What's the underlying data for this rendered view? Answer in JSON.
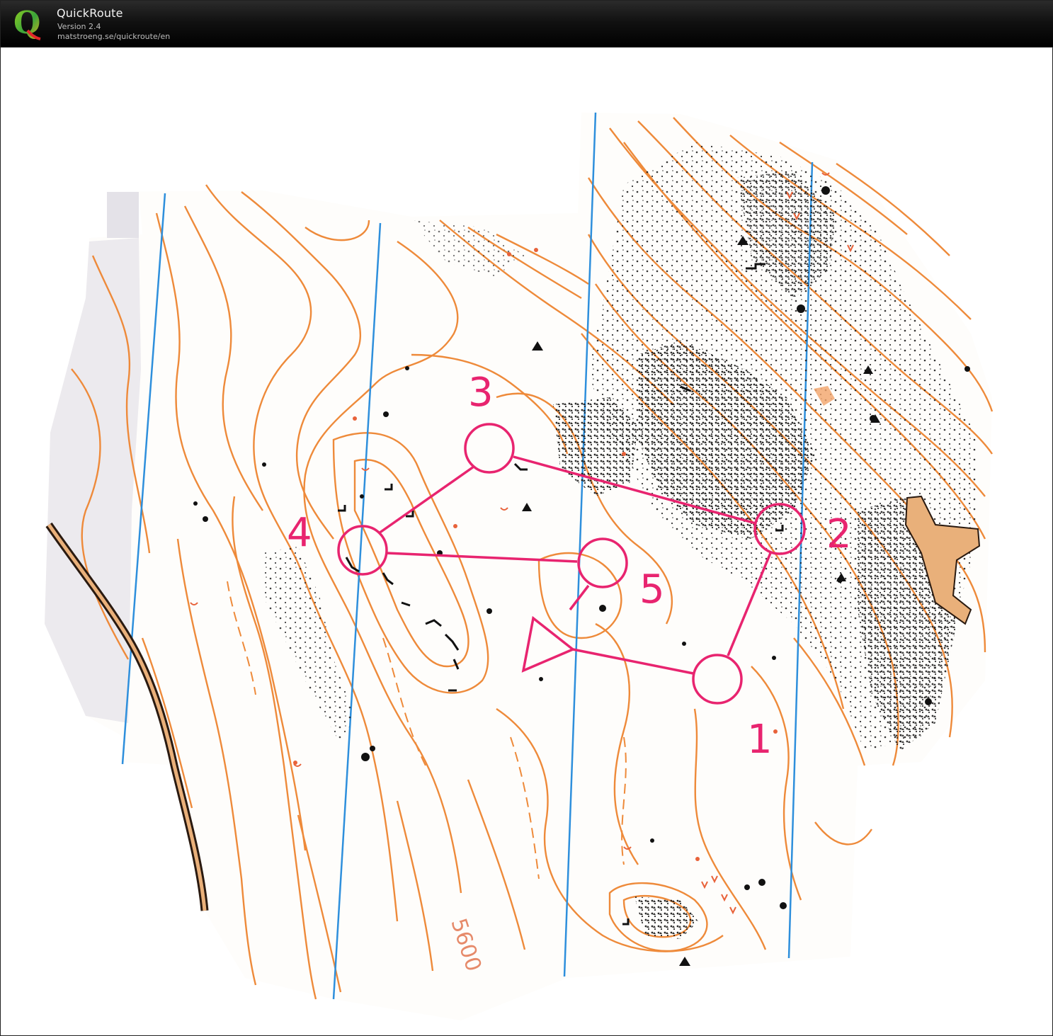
{
  "app": {
    "name": "QuickRoute",
    "version": "Version 2.4",
    "url": "matstroeng.se/quickroute/en",
    "logo_letter": "Q"
  },
  "map": {
    "colors": {
      "contour": "#ee8a3a",
      "magnetic_north": "#2e8fdc",
      "course": "#e8246f",
      "rock": "#111111",
      "road_fill": "#e9b07a",
      "road_edge": "#2a1a10"
    },
    "contour_label": "5600",
    "course": {
      "start_symbol": "triangle",
      "controls": [
        {
          "label": "1"
        },
        {
          "label": "2"
        },
        {
          "label": "3"
        },
        {
          "label": "4"
        },
        {
          "label": "5"
        }
      ]
    }
  }
}
